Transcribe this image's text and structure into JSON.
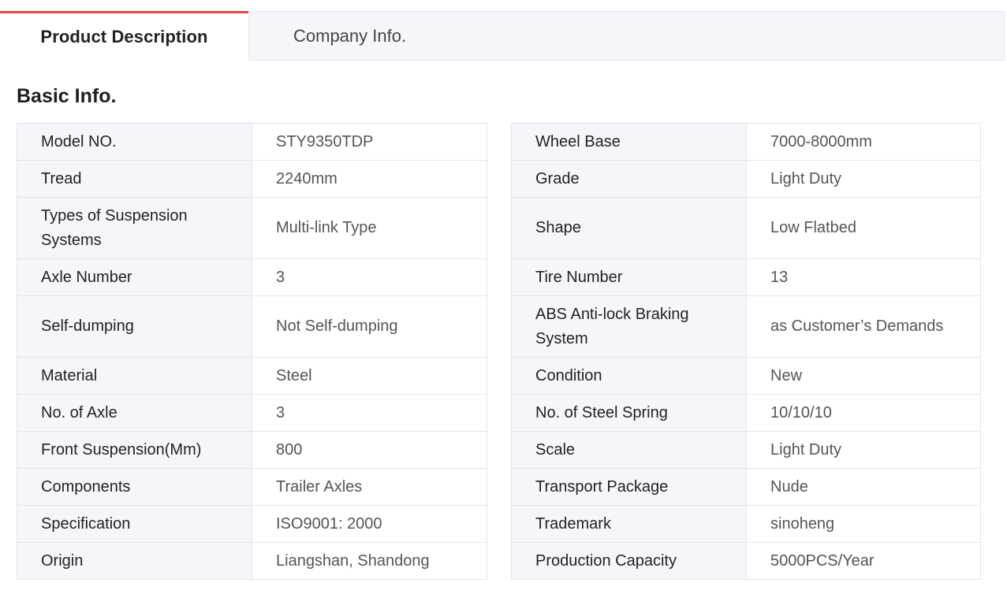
{
  "tabs": {
    "product_description": "Product Description",
    "company_info": "Company Info."
  },
  "accent_color": "#e04a4a",
  "section_title": "Basic Info.",
  "rows": [
    {
      "left": {
        "key": "Model NO.",
        "value": "STY9350TDP"
      },
      "right": {
        "key": "Wheel Base",
        "value": "7000-8000mm"
      }
    },
    {
      "left": {
        "key": "Tread",
        "value": "2240mm"
      },
      "right": {
        "key": "Grade",
        "value": "Light Duty"
      }
    },
    {
      "left": {
        "key": "Types of Suspension Systems",
        "value": "Multi-link Type"
      },
      "right": {
        "key": "Shape",
        "value": "Low Flatbed"
      }
    },
    {
      "left": {
        "key": "Axle Number",
        "value": "3"
      },
      "right": {
        "key": "Tire Number",
        "value": "13"
      }
    },
    {
      "left": {
        "key": "Self-dumping",
        "value": "Not Self-dumping"
      },
      "right": {
        "key": "ABS Anti-lock Braking System",
        "value": "as Customer’s Demands"
      }
    },
    {
      "left": {
        "key": "Material",
        "value": "Steel"
      },
      "right": {
        "key": "Condition",
        "value": "New"
      }
    },
    {
      "left": {
        "key": "No. of Axle",
        "value": "3"
      },
      "right": {
        "key": "No. of Steel Spring",
        "value": "10/10/10"
      }
    },
    {
      "left": {
        "key": "Front Suspension(Mm)",
        "value": "800"
      },
      "right": {
        "key": "Scale",
        "value": "Light Duty"
      }
    },
    {
      "left": {
        "key": "Components",
        "value": "Trailer Axles"
      },
      "right": {
        "key": "Transport Package",
        "value": "Nude"
      }
    },
    {
      "left": {
        "key": "Specification",
        "value": "ISO9001: 2000"
      },
      "right": {
        "key": "Trademark",
        "value": "sinoheng"
      }
    },
    {
      "left": {
        "key": "Origin",
        "value": "Liangshan, Shandong"
      },
      "right": {
        "key": "Production Capacity",
        "value": "5000PCS/Year"
      }
    }
  ]
}
